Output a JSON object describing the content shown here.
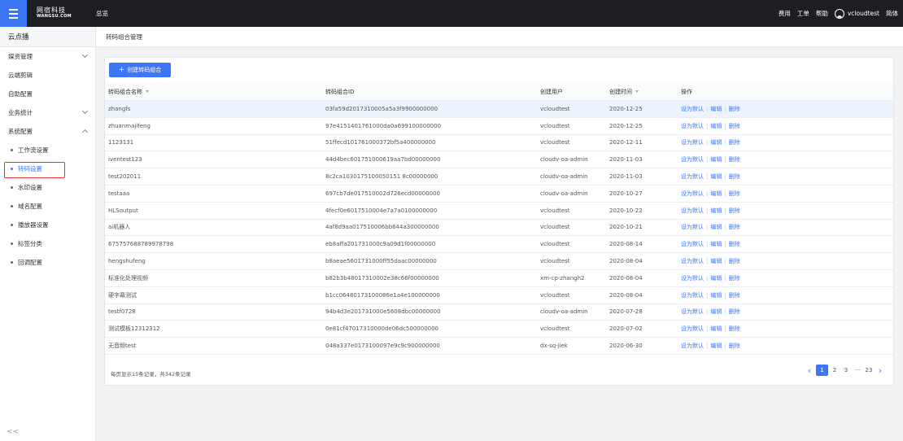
{
  "topbar": {
    "logo_line1": "网宿科技",
    "logo_line2": "WANGSU.COM",
    "overview": "总览",
    "links": [
      "费用",
      "工单",
      "帮助"
    ],
    "username": "vcloudtest",
    "language": "简体"
  },
  "sidebar": {
    "header": "云点播",
    "items": [
      {
        "label": "媒资管理",
        "chevron": "down"
      },
      {
        "label": "云端剪辑",
        "chevron": ""
      },
      {
        "label": "自助配置",
        "chevron": ""
      },
      {
        "label": "业务统计",
        "chevron": "down"
      },
      {
        "label": "系统配置",
        "chevron": "up"
      }
    ],
    "subitems": [
      {
        "label": "工作流设置",
        "active": false
      },
      {
        "label": "转码设置",
        "active": true
      },
      {
        "label": "水印设置",
        "active": false
      },
      {
        "label": "域名配置",
        "active": false
      },
      {
        "label": "播放器设置",
        "active": false
      },
      {
        "label": "标签分类",
        "active": false
      },
      {
        "label": "回调配置",
        "active": false
      }
    ],
    "collapse_icon": "double-chevron-left-icon"
  },
  "page": {
    "title": "转码组合管理",
    "create_button": "创建转码组合"
  },
  "table": {
    "columns": [
      "转码组合名称",
      "转码组合ID",
      "创建用户",
      "创建时间",
      "操作"
    ],
    "actions": [
      "设为默认",
      "编辑",
      "删除"
    ],
    "rows": [
      {
        "name": "zhangfs",
        "id": "03fa59d2017310005a5a3f9900000000",
        "user": "vcloudtest",
        "time": "2020-12-25"
      },
      {
        "name": "zhuanmajifeng",
        "id": "97e4151401761000da0a699100000000",
        "user": "vcloudtest",
        "time": "2020-12-25"
      },
      {
        "name": "1123131",
        "id": "51ffecd101761000372bf5a400000000",
        "user": "vcloudtest",
        "time": "2020-12-11"
      },
      {
        "name": "iventest123",
        "id": "44d4bec601751000619aa7bd00000000",
        "user": "cloudv-oa-admin",
        "time": "2020-11-03"
      },
      {
        "name": "test202011",
        "id": "8c2ca1030175100050151 8c00000000",
        "user": "cloudv-oa-admin",
        "time": "2020-11-03"
      },
      {
        "name": "testaaa",
        "id": "697cb7de017510002d726ecd00000000",
        "user": "cloudv-oa-admin",
        "time": "2020-10-27"
      },
      {
        "name": "HLSoutput",
        "id": "4fecf0e6017510004e7a7a0100000000",
        "user": "vcloudtest",
        "time": "2020-10-22"
      },
      {
        "name": "ai机器人",
        "id": "4af8d9aa017510006bb644a300000000",
        "user": "vcloudtest",
        "time": "2020-10-21"
      },
      {
        "name": "675757688789978798",
        "id": "eb8affa201731000c9a09d1f00000000",
        "user": "vcloudtest",
        "time": "2020-08-14"
      },
      {
        "name": "hengshufeng",
        "id": "b8aeae5601731000ff55daac00000000",
        "user": "vcloudtest",
        "time": "2020-08-04"
      },
      {
        "name": "标准化处理视频",
        "id": "b82b3b48017310002e38c66f00000000",
        "user": "xm-cp-zhangh2",
        "time": "2020-08-04"
      },
      {
        "name": "硬字幕测试",
        "id": "b1cc06480173100086e1a4e100000000",
        "user": "vcloudtest",
        "time": "2020-08-04"
      },
      {
        "name": "testf0728",
        "id": "94b4d3e201731000e5608dbc00000000",
        "user": "cloudv-oa-admin",
        "time": "2020-07-28"
      },
      {
        "name": "测试模板12312312",
        "id": "0e81cf47017310000de06dc500000000",
        "user": "vcloudtest",
        "time": "2020-07-02"
      },
      {
        "name": "无音频test",
        "id": "048a337e0173100097e9c9c900000000",
        "user": "dx-sq-jiek",
        "time": "2020-06-30"
      }
    ]
  },
  "pagination": {
    "summary": "每页显示15条记录，共342条记录",
    "pages": [
      "1",
      "2",
      "3",
      "···",
      "23"
    ],
    "current": "1"
  },
  "colors": {
    "accent": "#3d76f5",
    "topbar": "#1d1e24",
    "highlight_box": "#e8322d"
  }
}
